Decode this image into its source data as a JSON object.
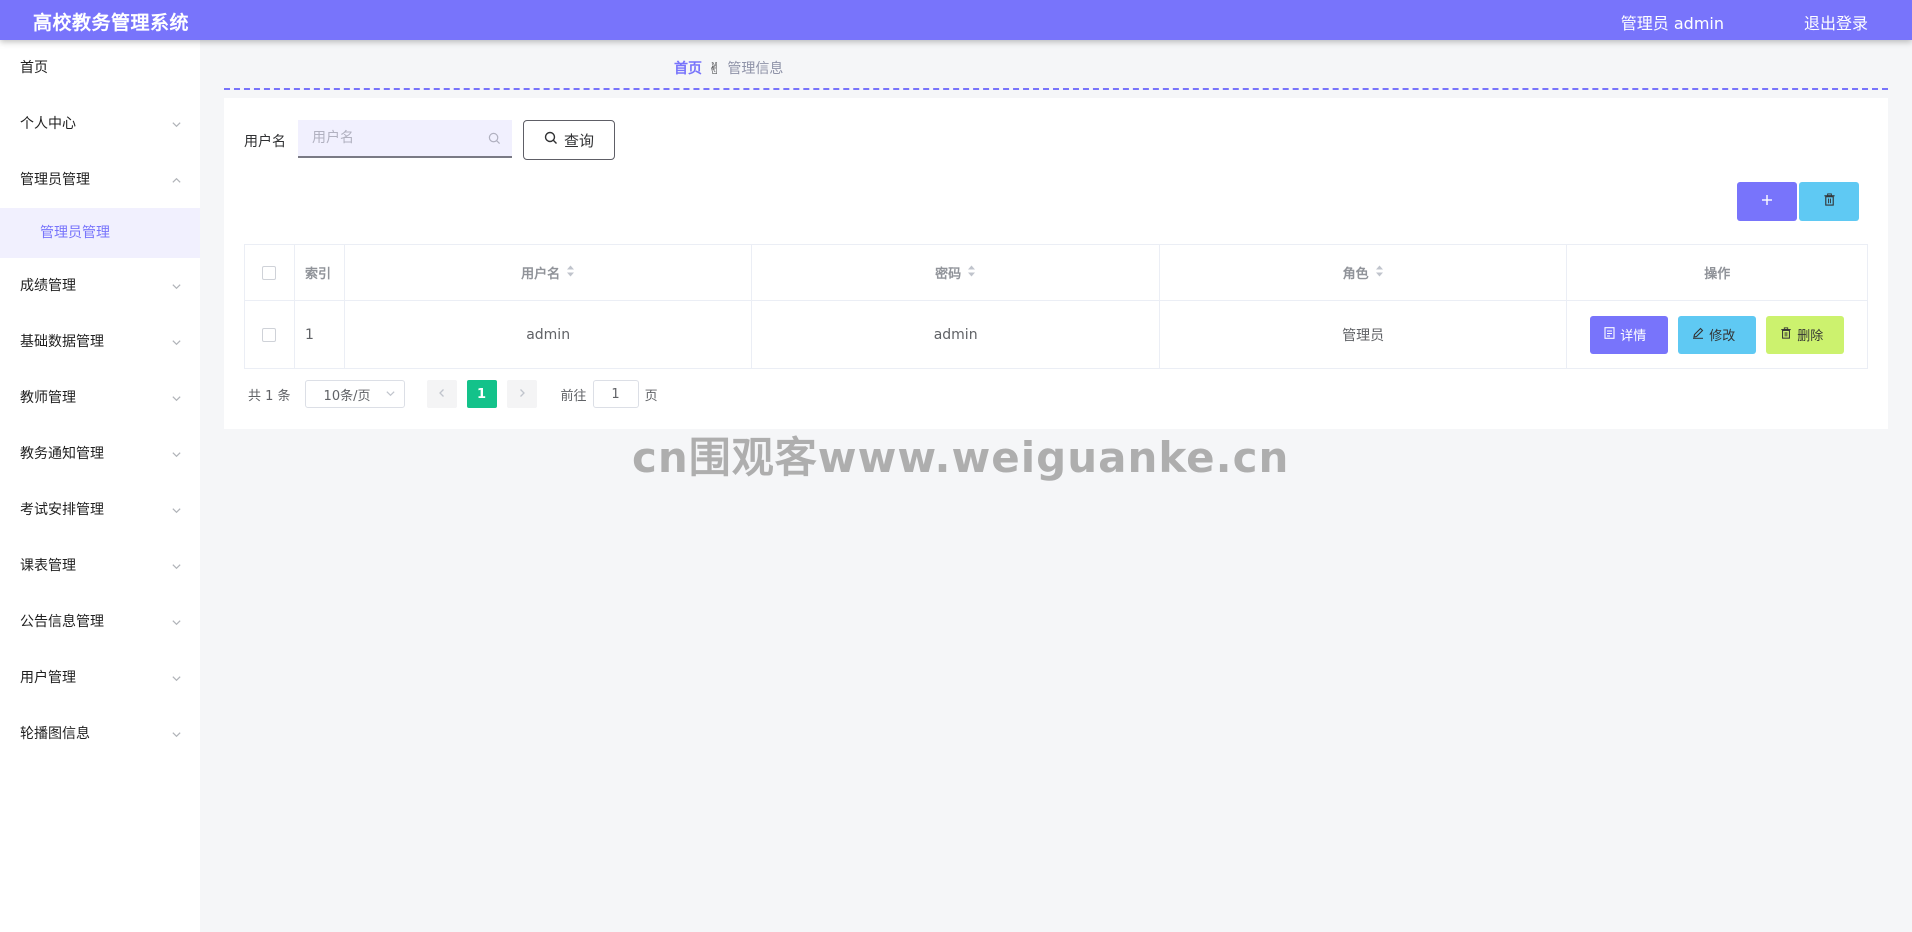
{
  "header": {
    "app_title": "高校教务管理系统",
    "user_info": "管理员 admin",
    "logout": "退出登录"
  },
  "sidebar": {
    "items": [
      {
        "label": "首页"
      },
      {
        "label": "个人中心"
      },
      {
        "label": "管理员管理"
      },
      {
        "label": "管理员管理"
      },
      {
        "label": "成绩管理"
      },
      {
        "label": "基础数据管理"
      },
      {
        "label": "教师管理"
      },
      {
        "label": "教务通知管理"
      },
      {
        "label": "考试安排管理"
      },
      {
        "label": "课表管理"
      },
      {
        "label": "公告信息管理"
      },
      {
        "label": "用户管理"
      },
      {
        "label": "轮播图信息"
      }
    ]
  },
  "breadcrumb": {
    "home": "首页",
    "current": "管理信息"
  },
  "search": {
    "label": "用户名",
    "placeholder": "用户名",
    "value": "",
    "query_button": "查询"
  },
  "table": {
    "headers": {
      "index": "索引",
      "username": "用户名",
      "password": "密码",
      "role": "角色",
      "actions": "操作"
    },
    "rows": [
      {
        "index": "1",
        "username": "admin",
        "password": "admin",
        "role": "管理员"
      }
    ],
    "row_actions": {
      "detail": "详情",
      "edit": "修改",
      "delete": "删除"
    }
  },
  "pagination": {
    "total": "共 1 条",
    "page_size": "10条/页",
    "current_page": "1",
    "goto_prefix": "前往",
    "goto_value": "1",
    "goto_suffix": "页"
  },
  "watermark": "cn围观客www.weiguanke.cn",
  "colors": {
    "primary": "#7874fb",
    "info": "#5fc9f3",
    "warning": "#ccf26e",
    "success": "#13c28a"
  }
}
